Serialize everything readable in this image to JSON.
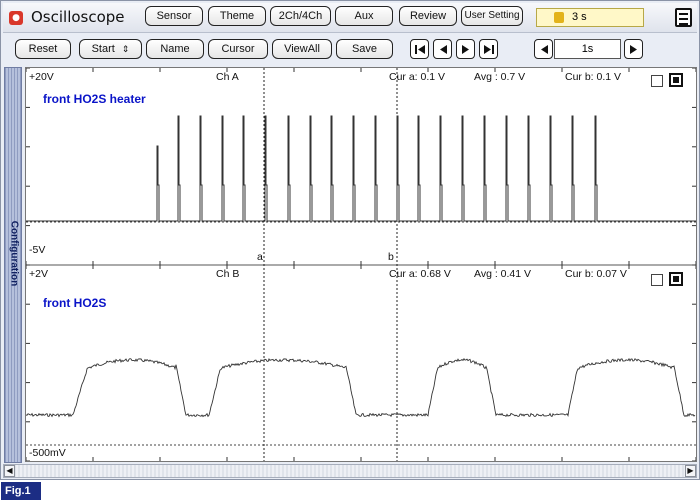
{
  "app": {
    "title": "Oscilloscope"
  },
  "header": {
    "buttons": {
      "sensor": "Sensor",
      "theme": "Theme",
      "channels": "2Ch/4Ch",
      "aux": "Aux",
      "review": "Review",
      "user_setting": "User Setting"
    },
    "timer": "3 s"
  },
  "toolbar": {
    "reset": "Reset",
    "start": "Start",
    "name": "Name",
    "cursor": "Cursor",
    "viewall": "ViewAll",
    "save": "Save",
    "zoom_value": "1s"
  },
  "sidebar": {
    "label": "Configuration"
  },
  "channel_a": {
    "top_label": "+20V",
    "bottom_label": "-5V",
    "ch": "Ch A",
    "name": "front HO2S heater",
    "cur_a": "Cur a: 0.1 V",
    "avg": "Avg   : 0.7 V",
    "cur_b": "Cur b: 0.1 V"
  },
  "channel_b": {
    "top_label": "+2V",
    "bottom_label": "-500mV",
    "ch": "Ch B",
    "name": "front HO2S",
    "cur_a": "Cur a: 0.68 V",
    "avg": "Avg   : 0.41 V",
    "cur_b": "Cur b: 0.07 V"
  },
  "cursors": {
    "a": "a",
    "b": "b"
  },
  "figure_label": "Fig.1",
  "icons": {
    "app": "record-icon",
    "timer": "clock-icon",
    "menu": "menu-icon"
  },
  "colors": {
    "trace": "#333333",
    "channel_name": "#0a14c8",
    "figure_bg": "#1c2d84"
  }
}
